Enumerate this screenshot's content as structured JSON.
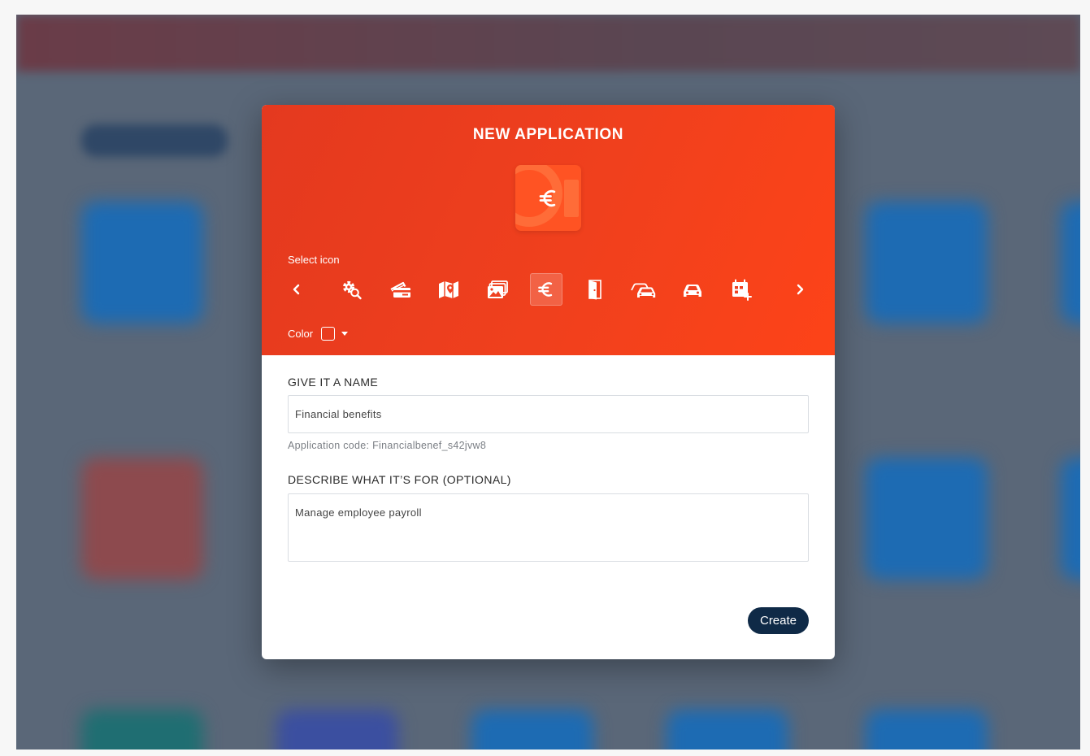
{
  "modal": {
    "title": "NEW APPLICATION",
    "accent_color": "#f0401d",
    "selected_icon": "euro-icon",
    "select_icon_label": "Select icon",
    "icons": [
      {
        "name": "chevron-left-icon"
      },
      {
        "name": "gear-search-icon"
      },
      {
        "name": "credit-cards-icon"
      },
      {
        "name": "map-pin-icon"
      },
      {
        "name": "photos-icon"
      },
      {
        "name": "euro-icon"
      },
      {
        "name": "door-icon"
      },
      {
        "name": "cars-icon"
      },
      {
        "name": "car-icon"
      },
      {
        "name": "calendar-add-icon"
      },
      {
        "name": "chevron-right-icon"
      }
    ],
    "color_label": "Color",
    "name_section": {
      "label": "GIVE IT A NAME",
      "value": "Financial benefits",
      "hint": "Application code: Financialbenef_s42jvw8"
    },
    "description_section": {
      "label": "DESCRIBE WHAT IT’S FOR (OPTIONAL)",
      "value": "Manage employee payroll"
    },
    "create_label": "Create",
    "create_color": "#0f2a47"
  }
}
